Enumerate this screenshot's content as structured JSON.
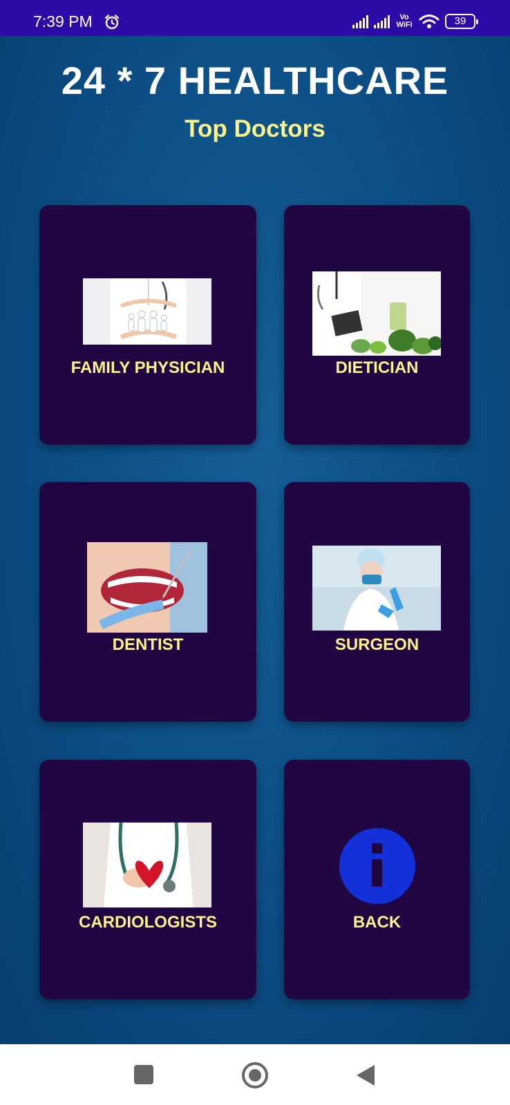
{
  "status_bar": {
    "time": "7:39 PM",
    "vo": "Vo",
    "wifi_label": "WiFi",
    "battery": "39"
  },
  "header": {
    "title": "24 * 7 HEALTHCARE",
    "subtitle": "Top Doctors"
  },
  "cards": [
    {
      "label": "FAMILY PHYSICIAN",
      "icon": "family-physician-photo"
    },
    {
      "label": "DIETICIAN",
      "icon": "dietician-photo"
    },
    {
      "label": "DENTIST",
      "icon": "dentist-photo"
    },
    {
      "label": "SURGEON",
      "icon": "surgeon-photo"
    },
    {
      "label": "CARDIOLOGISTS",
      "icon": "cardiologist-photo"
    },
    {
      "label": "BACK",
      "icon": "info-icon"
    }
  ],
  "colors": {
    "status_bar": "#2e0aa8",
    "background": "#0d4f85",
    "card": "#200743",
    "accent_text": "#fbf38a",
    "info_icon": "#1430d8"
  }
}
